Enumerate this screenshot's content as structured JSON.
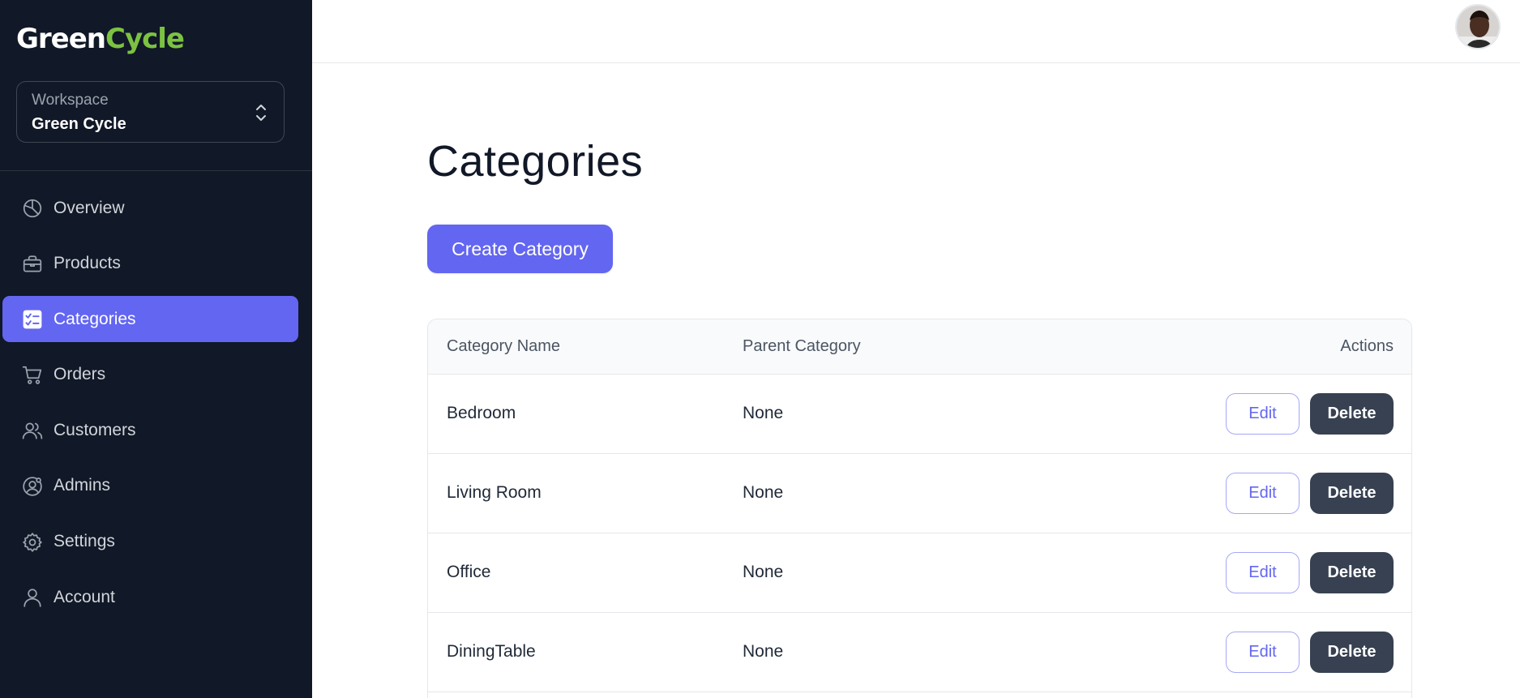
{
  "brand": {
    "part1": "Green",
    "part2": "Cycle",
    "accent": "#7cc242"
  },
  "workspace": {
    "label": "Workspace",
    "value": "Green Cycle",
    "icon": "chevron-up-down-icon"
  },
  "sidebar": {
    "items": [
      {
        "label": "Overview",
        "icon": "pie-chart-icon",
        "active": false
      },
      {
        "label": "Products",
        "icon": "briefcase-icon",
        "active": false
      },
      {
        "label": "Categories",
        "icon": "checklist-icon",
        "active": true
      },
      {
        "label": "Orders",
        "icon": "shopping-cart-icon",
        "active": false
      },
      {
        "label": "Customers",
        "icon": "users-icon",
        "active": false
      },
      {
        "label": "Admins",
        "icon": "user-gear-icon",
        "active": false
      },
      {
        "label": "Settings",
        "icon": "gear-icon",
        "active": false
      },
      {
        "label": "Account",
        "icon": "user-icon",
        "active": false
      }
    ]
  },
  "header": {
    "avatar_icon": "user-avatar"
  },
  "main": {
    "title": "Categories",
    "create_label": "Create Category",
    "table": {
      "columns": [
        "Category Name",
        "Parent Category",
        "Actions"
      ],
      "rows": [
        {
          "name": "Bedroom",
          "parent": "None"
        },
        {
          "name": "Living Room",
          "parent": "None"
        },
        {
          "name": "Office",
          "parent": "None"
        },
        {
          "name": "DiningTable",
          "parent": "None"
        }
      ],
      "edit_label": "Edit",
      "delete_label": "Delete"
    }
  },
  "colors": {
    "sidebar_bg": "#111827",
    "accent": "#6366f1",
    "delete_bg": "#374151"
  }
}
